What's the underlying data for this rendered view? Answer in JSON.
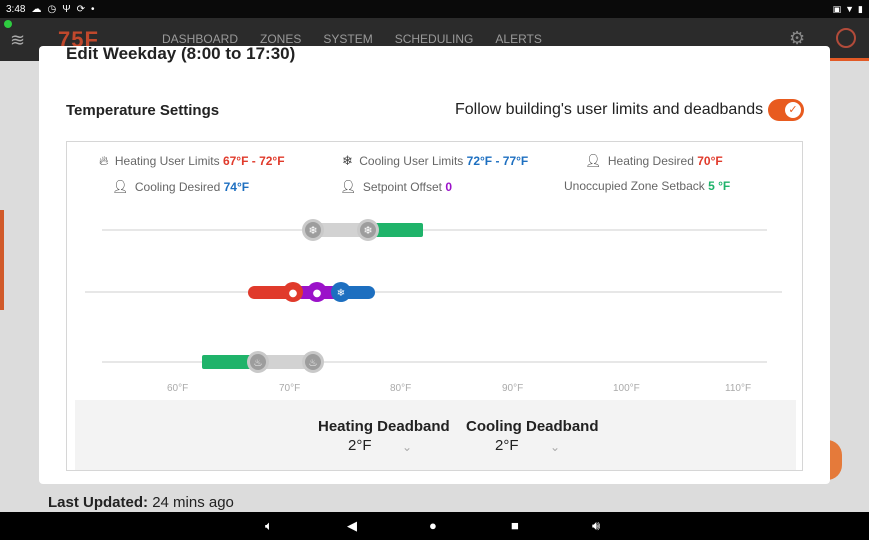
{
  "statusbar": {
    "time": "3:48",
    "icons": [
      "cloud-icon",
      "clock-icon",
      "usb-icon",
      "sync-icon"
    ],
    "right_icons": [
      "no-sim-icon",
      "wifi-icon",
      "battery-icon"
    ]
  },
  "appbar": {
    "logo": "75F",
    "nav": [
      "DASHBOARD",
      "ZONES",
      "SYSTEM",
      "SCHEDULING",
      "ALERTS"
    ]
  },
  "modal": {
    "cut_title": "Edit Weekday (8:00 to 17:30)",
    "section_title": "Temperature Settings",
    "follow_label": "Follow building's user limits and deadbands",
    "follow_enabled": true,
    "legend": {
      "heating_user_limits": {
        "label": "Heating User Limits",
        "value": "67°F - 72°F"
      },
      "cooling_user_limits": {
        "label": "Cooling User Limits",
        "value": "72°F - 77°F"
      },
      "heating_desired": {
        "label": "Heating Desired",
        "value": "70°F"
      },
      "cooling_desired": {
        "label": "Cooling Desired",
        "value": "74°F"
      },
      "setpoint_offset": {
        "label": "Setpoint Offset",
        "value": "0"
      },
      "unoccupied_setback": {
        "label": "Unoccupied Zone Setback",
        "value": "5 °F"
      }
    },
    "axis_ticks": [
      "60°F",
      "70°F",
      "80°F",
      "90°F",
      "100°F",
      "110°F"
    ],
    "heating_deadband": {
      "label": "Heating Deadband",
      "value": "2°F"
    },
    "cooling_deadband": {
      "label": "Cooling Deadband",
      "value": "2°F"
    }
  },
  "footer": {
    "last_updated_label": "Last Updated:",
    "last_updated_value": "24 mins ago"
  },
  "colors": {
    "heat": "#e03a2b",
    "cool": "#1d6fc0",
    "offset": "#9b12c9",
    "green": "#1fb36a",
    "accent": "#e85b1f"
  }
}
